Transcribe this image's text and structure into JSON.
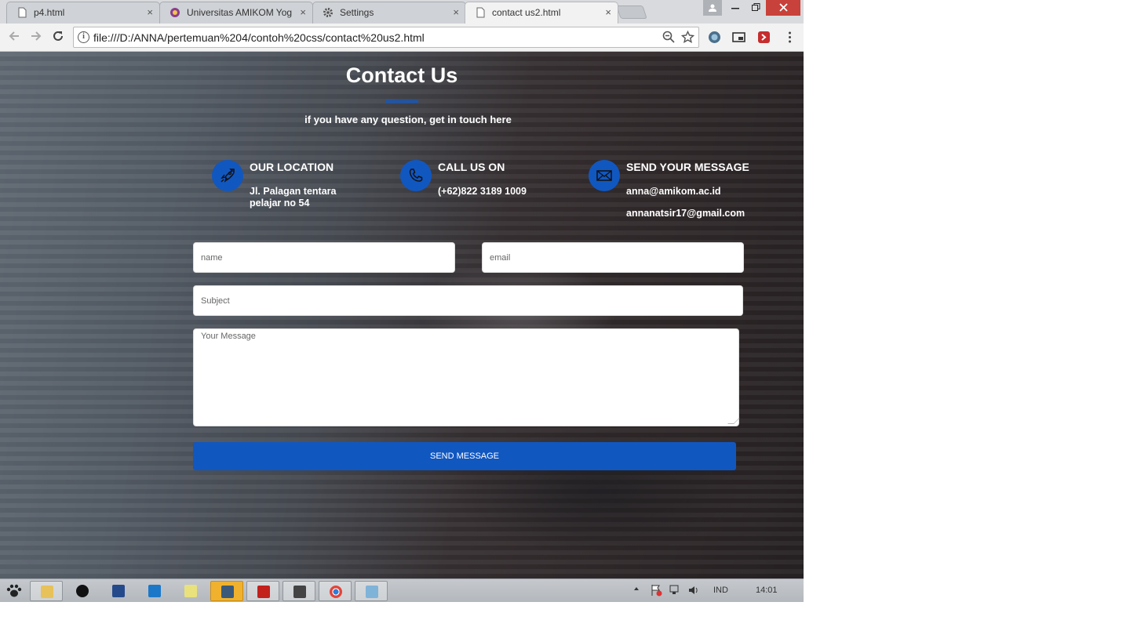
{
  "browser": {
    "tabs": [
      {
        "title": "p4.html",
        "active": false,
        "favicon": "document-icon"
      },
      {
        "title": "Universitas AMIKOM Yog",
        "active": false,
        "favicon": "amikom-logo-icon"
      },
      {
        "title": "Settings",
        "active": false,
        "favicon": "gear-icon"
      },
      {
        "title": "contact us2.html",
        "active": true,
        "favicon": "document-icon"
      }
    ],
    "tab_close_glyph": "×",
    "url": "file:///D:/ANNA/pertemuan%204/contoh%20css/contact%20us2.html"
  },
  "page": {
    "title": "Contact Us",
    "subtitle": "if you have any question, get in touch here",
    "accent_color": "#1157c0",
    "info": [
      {
        "icon": "rocket-icon",
        "heading": "OUR LOCATION",
        "lines": [
          "Jl. Palagan tentara",
          "pelajar no 54"
        ]
      },
      {
        "icon": "phone-icon",
        "heading": "CALL US ON",
        "lines": [
          "(+62)822 3189 1009"
        ]
      },
      {
        "icon": "envelope-icon",
        "heading": "SEND YOUR MESSAGE",
        "lines": [
          "anna@amikom.ac.id",
          "annanatsir17@gmail.com"
        ]
      }
    ],
    "form": {
      "name_placeholder": "name",
      "email_placeholder": "email",
      "subject_placeholder": "Subject",
      "message_placeholder": "Your Message",
      "submit_label": "SEND MESSAGE"
    }
  },
  "taskbar": {
    "language": "IND",
    "clock": "14:01"
  }
}
